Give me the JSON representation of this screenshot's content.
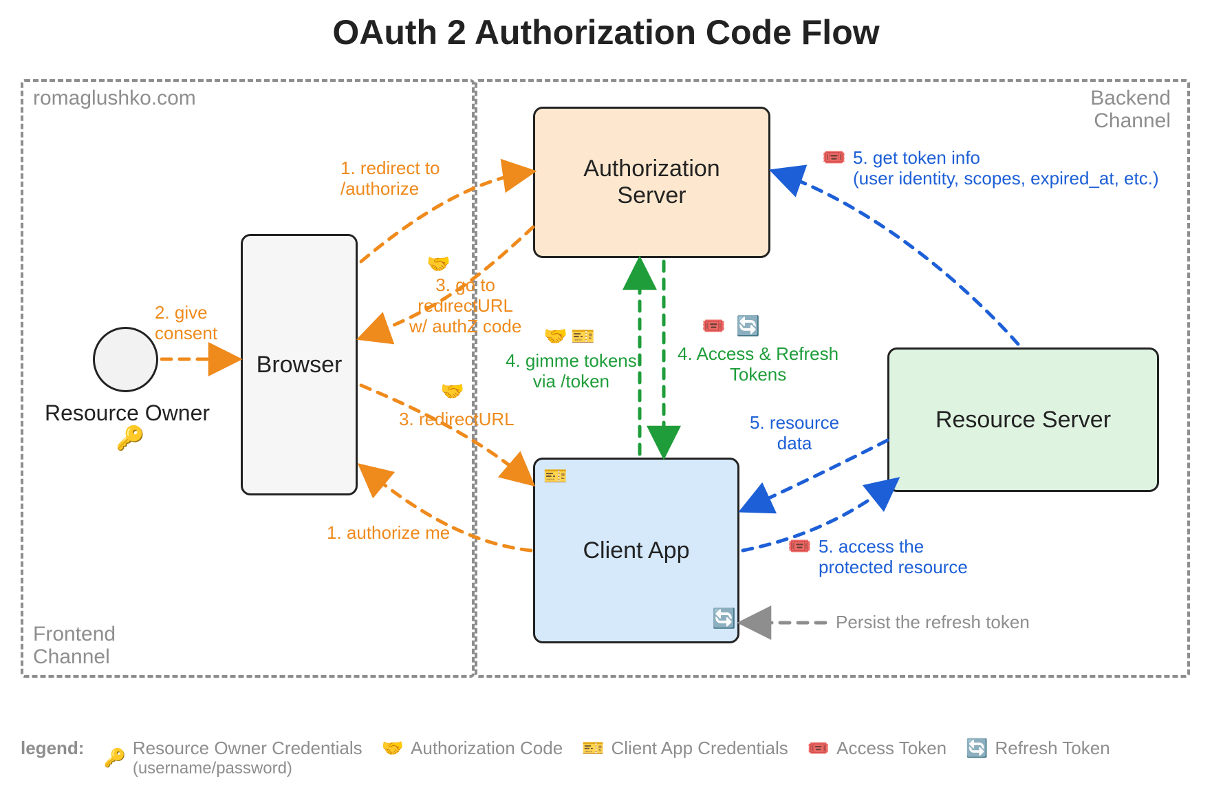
{
  "title": "OAuth 2 Authorization Code Flow",
  "attribution": "romaglushko.com",
  "channels": {
    "frontend": "Frontend\nChannel",
    "backend": "Backend\nChannel"
  },
  "actors": {
    "resource_owner": "Resource Owner",
    "browser": "Browser",
    "auth_server": "Authorization\nServer",
    "client_app": "Client App",
    "resource_server": "Resource Server"
  },
  "steps": {
    "s1a": "1. redirect to\n/authorize",
    "s1b": "1. authorize me",
    "s2": "2. give\nconsent",
    "s3a": "3. go to\nredirectURL\nw/ authZ code",
    "s3b": "3. redirectURL",
    "s4a": "4. gimme tokens\nvia /token",
    "s4b": "4. Access & Refresh\nTokens",
    "s5a": "5. get token info\n(user identity, scopes, expired_at, etc.)",
    "s5b": "5. resource\ndata",
    "s5c": "5. access the\nprotected resource",
    "persist": "Persist the refresh token"
  },
  "icons": {
    "key": "🔑",
    "handshake": "🤝",
    "ticket_client": "🎫",
    "ticket_access": "🎟️",
    "refresh": "🔄"
  },
  "legend": {
    "label": "legend:",
    "owner_creds": "Resource Owner Credentials",
    "owner_creds_sub": "(username/password)",
    "auth_code": "Authorization Code",
    "client_creds": "Client App Credentials",
    "access_token": "Access Token",
    "refresh_token": "Refresh Token"
  },
  "colors": {
    "orange": "#ef8a1c",
    "green": "#1f9d3a",
    "blue": "#1d5fd6",
    "gray": "#8e8e8e",
    "auth_fill": "#fde8cf",
    "client_fill": "#d6e9fb",
    "resource_fill": "#dff3e1",
    "browser_fill": "#f6f6f6"
  }
}
